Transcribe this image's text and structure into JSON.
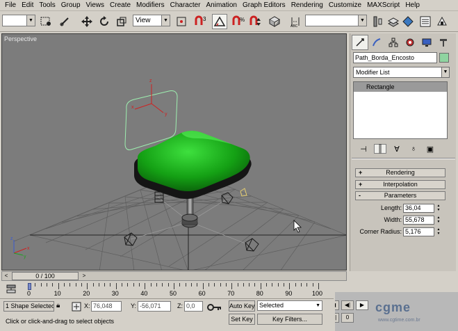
{
  "menu": {
    "items": [
      "File",
      "Edit",
      "Tools",
      "Group",
      "Views",
      "Create",
      "Modifiers",
      "Character",
      "Animation",
      "Graph Editors",
      "Rendering",
      "Customize",
      "MAXScript",
      "Help"
    ]
  },
  "toolbar": {
    "selection_filter": "",
    "reference_coord": "View",
    "named_selection": ""
  },
  "viewport": {
    "label": "Perspective",
    "colors": {
      "background": "#7c7c7c",
      "seat": "#1a8a1a",
      "grid": "#5e5e5e",
      "spline": "#9ef0b0"
    }
  },
  "command_panel": {
    "tabs": [
      "create-tab",
      "modify-tab",
      "hierarchy-tab",
      "motion-tab",
      "display-tab",
      "utilities-tab"
    ],
    "object_name": "Path_Borda_Encosto",
    "object_color": "#8fd4a0",
    "modifier_list": "Modifier List",
    "stack": [
      "Rectangle"
    ],
    "rollouts": {
      "rendering": "Rendering",
      "interpolation": "Interpolation",
      "parameters": "Parameters"
    },
    "params": {
      "length_label": "Length:",
      "length_value": "36,04",
      "width_label": "Width:",
      "width_value": "55,678",
      "corner_label": "Corner Radius:",
      "corner_value": "5,176"
    }
  },
  "time": {
    "slider_label": "0 / 100",
    "ticks": [
      "0",
      "10",
      "20",
      "30",
      "40",
      "50",
      "60",
      "70",
      "80",
      "90",
      "100"
    ]
  },
  "status": {
    "selection": "1 Shape Selected",
    "x_label": "X:",
    "x_value": "76,048",
    "y_label": "Y:",
    "y_value": "-56,071",
    "z_label": "Z:",
    "z_value": "0,0",
    "auto_key": "Auto Key",
    "set_key": "Set Key",
    "key_mode": "Selected",
    "key_filters": "Key Filters...",
    "prompt": "Click or click-and-drag to select objects"
  },
  "watermark": {
    "logo": "cgme",
    "url": "www.cgtime.com.br"
  }
}
